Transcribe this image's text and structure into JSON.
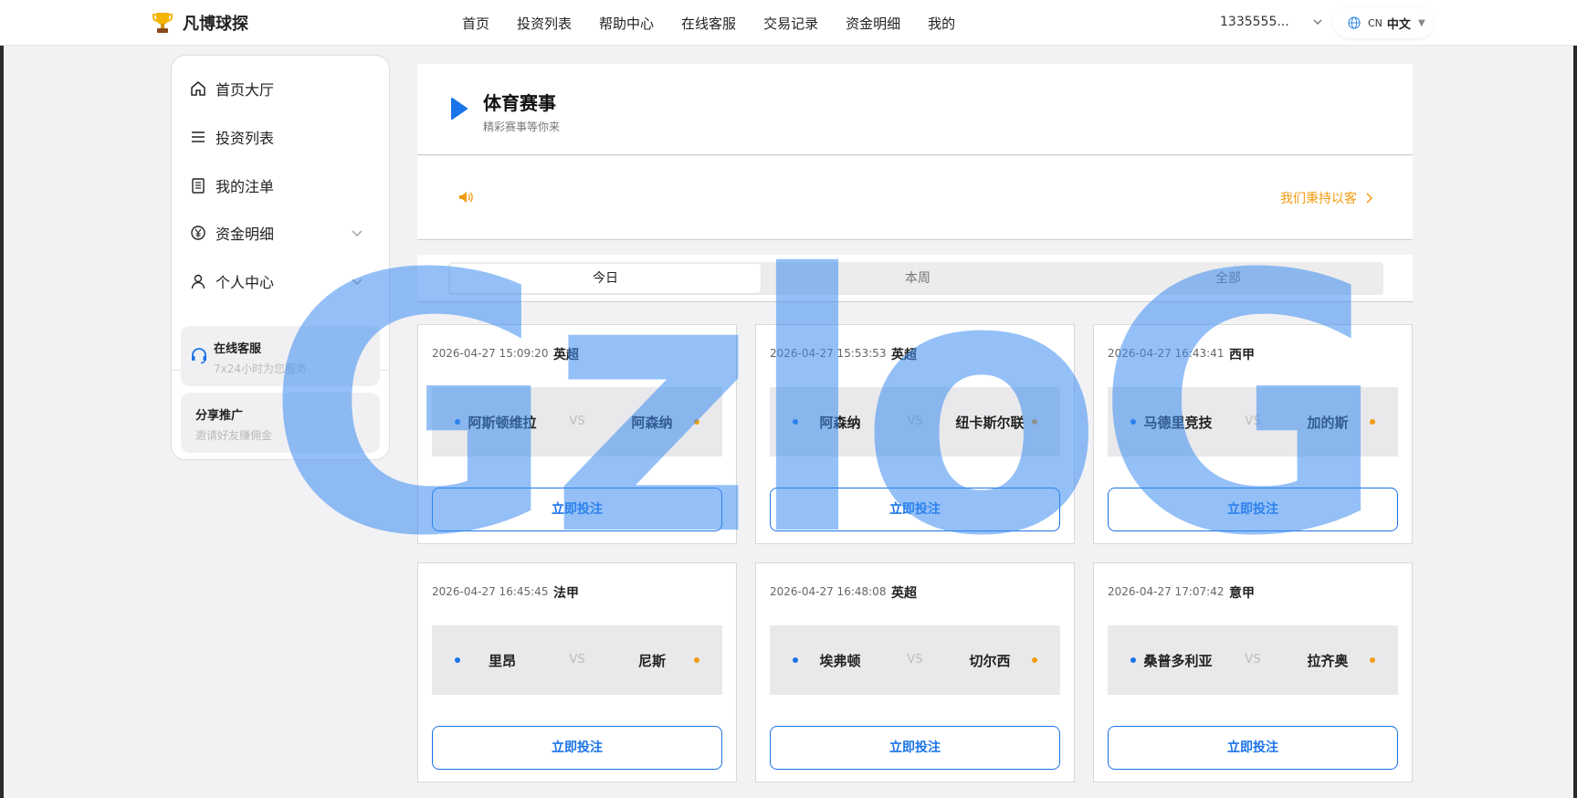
{
  "brand": {
    "name": "凡博球探"
  },
  "nav": {
    "items": [
      "首页",
      "投资列表",
      "帮助中心",
      "在线客服",
      "交易记录",
      "资金明细",
      "我的"
    ]
  },
  "account": {
    "label": "1335555..."
  },
  "language": {
    "code": "CN",
    "name": "中文"
  },
  "sidebar": {
    "items": [
      {
        "label": "首页大厅",
        "icon": "home-icon"
      },
      {
        "label": "投资列表",
        "icon": "list-icon"
      },
      {
        "label": "我的注单",
        "icon": "document-icon"
      },
      {
        "label": "资金明细",
        "icon": "yuan-icon"
      },
      {
        "label": "个人中心",
        "icon": "user-icon"
      }
    ],
    "service": {
      "title": "在线客服",
      "sub": "7x24小时为您服务"
    },
    "share": {
      "title": "分享推广",
      "sub": "邀请好友赚佣金"
    }
  },
  "header": {
    "title": "体育赛事",
    "subtitle": "精彩赛事等你来"
  },
  "notice": {
    "text": "我们秉持以客"
  },
  "tabs": [
    "今日",
    "本周",
    "全部"
  ],
  "matches": [
    {
      "time": "2026-04-27 15:09:20",
      "league": "英超",
      "home": "阿斯顿维拉",
      "away": "阿森纳",
      "vs": "VS",
      "button": "立即投注"
    },
    {
      "time": "2026-04-27 15:53:53",
      "league": "英超",
      "home": "阿森纳",
      "away": "纽卡斯尔联",
      "vs": "VS",
      "button": "立即投注"
    },
    {
      "time": "2026-04-27 16:43:41",
      "league": "西甲",
      "home": "马德里竞技",
      "away": "加的斯",
      "vs": "VS",
      "button": "立即投注"
    },
    {
      "time": "2026-04-27 16:45:45",
      "league": "法甲",
      "home": "里昂",
      "away": "尼斯",
      "vs": "VS",
      "button": "立即投注"
    },
    {
      "time": "2026-04-27 16:48:08",
      "league": "英超",
      "home": "埃弗顿",
      "away": "切尔西",
      "vs": "VS",
      "button": "立即投注"
    },
    {
      "time": "2026-04-27 17:07:42",
      "league": "意甲",
      "home": "桑普多利亚",
      "away": "拉齐奥",
      "vs": "VS",
      "button": "立即投注"
    }
  ],
  "watermark": {
    "text": "GzloG"
  },
  "colors": {
    "accent": "#1a73e8",
    "warning": "#f39c12",
    "watermark": "#3c8cf0"
  }
}
